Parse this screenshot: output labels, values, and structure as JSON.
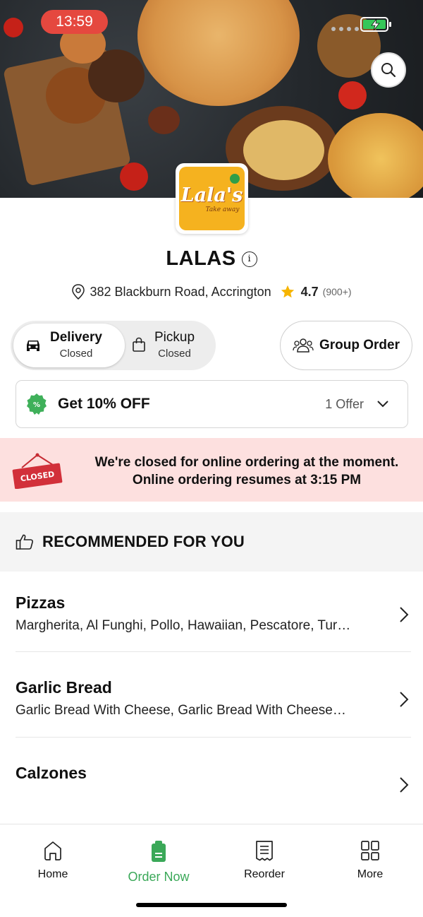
{
  "status_bar": {
    "time": "13:59"
  },
  "hero": {
    "search_icon": "search-icon"
  },
  "restaurant": {
    "logo_text": "Lala's",
    "logo_subtext": "Take away",
    "name": "LALAS",
    "address": "382 Blackburn Road, Accrington",
    "rating": "4.7",
    "rating_count": "(900+)"
  },
  "order_type": {
    "options": [
      {
        "label": "Delivery",
        "status": "Closed",
        "icon": "car-icon",
        "selected": true
      },
      {
        "label": "Pickup",
        "status": "Closed",
        "icon": "bag-icon",
        "selected": false
      }
    ],
    "group_order_label": "Group Order"
  },
  "offer": {
    "title": "Get 10% OFF",
    "count": "1 Offer"
  },
  "closed_banner": {
    "sign_text": "CLOSED",
    "line1": "We're closed for online ordering at the moment.",
    "line2": "Online ordering resumes at 3:15 PM"
  },
  "recommended": {
    "heading": "RECOMMENDED FOR YOU"
  },
  "categories": [
    {
      "name": "Pizzas",
      "desc": "Margherita, Al Funghi, Pollo, Hawaiian, Pescatore, Tur…"
    },
    {
      "name": "Garlic Bread",
      "desc": "Garlic Bread With Cheese, Garlic Bread With Cheese…"
    },
    {
      "name": "Calzones",
      "desc": ""
    }
  ],
  "nav": {
    "items": [
      {
        "label": "Home",
        "icon": "home-icon"
      },
      {
        "label": "Order Now",
        "icon": "order-icon",
        "active": true
      },
      {
        "label": "Reorder",
        "icon": "receipt-icon"
      },
      {
        "label": "More",
        "icon": "grid-icon"
      }
    ]
  },
  "colors": {
    "accent_green": "#3aa858",
    "closed_bg": "#fde0df",
    "time_pill": "#e5483f",
    "logo_yellow": "#f5b21f"
  }
}
